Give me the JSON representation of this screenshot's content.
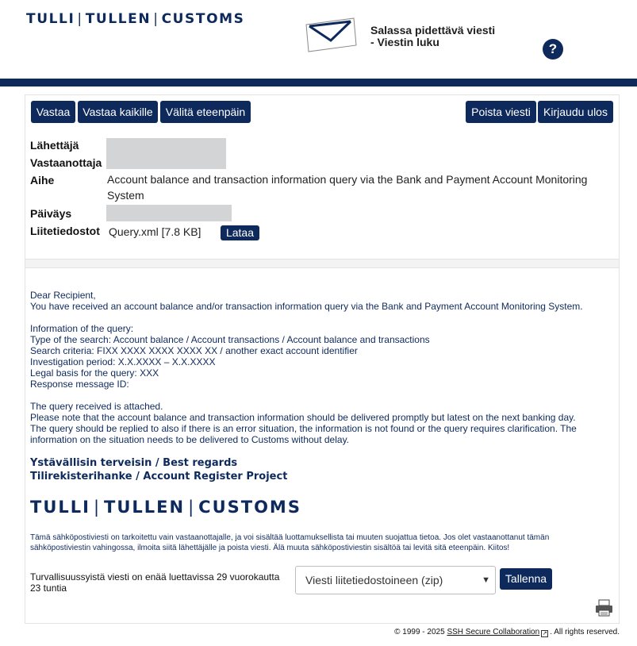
{
  "header": {
    "brand_parts": [
      "TULLI",
      "TULLEN",
      "CUSTOMS"
    ],
    "title_line1": "Salassa pidettävä viesti",
    "title_line2": "- Viestin luku",
    "help_symbol": "?",
    "icons": {
      "envelope": "envelope-icon",
      "help": "help-icon"
    },
    "accent_color": "#0e2a5c"
  },
  "toolbar": {
    "reply": "Vastaa",
    "reply_all": "Vastaa kaikille",
    "forward": "Välitä eteenpäin",
    "delete": "Poista viesti",
    "logout": "Kirjaudu ulos"
  },
  "meta": {
    "sender_label": "Lähettäjä",
    "recipient_label": "Vastaanottaja",
    "subject_label": "Aihe",
    "subject_value": "Account balance and transaction information query via the Bank and Payment Account Monitoring System",
    "date_label": "Päiväys",
    "attachments_label": "Liitetiedostot",
    "attachment_name": "Query.xml [7.8 KB]",
    "download_label": "Lataa"
  },
  "message": {
    "lines": [
      "Dear Recipient,",
      "You have received an account balance and/or transaction information query via the Bank and Payment Account Monitoring System.",
      "",
      "Information of the query:",
      "Type of the search: Account balance / Account transactions / Account balance and transactions",
      "Search criteria: FIXX XXXX XXXX XXXX XX / another exact account identifier",
      "Investigation period: X.X.XXXX – X.X.XXXX",
      "Legal basis for the query: XXX",
      "Response message ID:",
      "",
      "The query received is attached.",
      "Please note that the account balance and transaction information should be delivered promptly but latest on the next banking day.",
      "The query should be replied to also if there is an error situation, the information is not found or the query requires clarification. The",
      "information on the situation needs to be delivered to Customs without delay."
    ],
    "signature_line1": "Ystävällisin terveisin / Best regards",
    "signature_line2": "Tilirekisterihanke / Account Register Project",
    "disclaimer": "Tämä sähköpostiviesti on tarkoitettu vain vastaanottajalle, ja voi sisältää luottamuksellista tai muuten suojattua tietoa. Jos olet vastaanottanut tämän sähköpostiviestin vahingossa, ilmoita siitä lähettäjälle ja poista viesti. Älä muuta sähköpostiviestin sisältöä tai levitä sitä eteenpäin. Kiitos!"
  },
  "save": {
    "expiry_text": "Turvallisuussyistä viesti on enää luettavissa 29 vuorokautta 23 tuntia",
    "select_value": "Viesti liitetiedostoineen (zip)",
    "save_label": "Tallenna",
    "printer_icon": "printer-icon"
  },
  "footer": {
    "prefix": "© 1999 - 2025 ",
    "link": "SSH Secure Collaboration",
    "suffix": ". All rights reserved."
  }
}
